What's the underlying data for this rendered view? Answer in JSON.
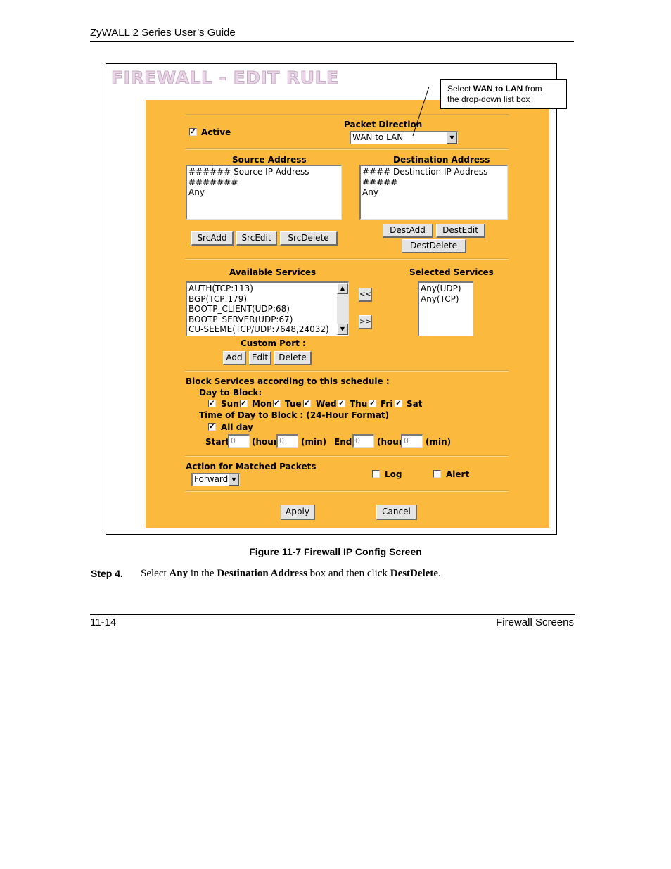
{
  "header": {
    "title": "ZyWALL 2 Series User’s Guide"
  },
  "screen": {
    "title": "FIREWALL - EDIT RULE",
    "active_label": "Active",
    "active_checked": true,
    "packet_direction_label": "Packet Direction",
    "packet_direction_value": "WAN to LAN",
    "source_address_label": "Source Address",
    "source_list": [
      "###### Source IP Address #######",
      "Any"
    ],
    "destination_address_label": "Destination Address",
    "destination_list": [
      "#### Destinction IP Address #####",
      "Any"
    ],
    "src_buttons": {
      "add": "SrcAdd",
      "edit": "SrcEdit",
      "delete": "SrcDelete"
    },
    "dest_buttons": {
      "add": "DestAdd",
      "edit": "DestEdit",
      "delete": "DestDelete"
    },
    "available_services_label": "Available Services",
    "available_services": [
      "AUTH(TCP:113)",
      "BGP(TCP:179)",
      "BOOTP_CLIENT(UDP:68)",
      "BOOTP_SERVER(UDP:67)",
      "CU-SEEME(TCP/UDP:7648,24032)"
    ],
    "selected_services_label": "Selected Services",
    "selected_services": [
      "Any(UDP)",
      "Any(TCP)"
    ],
    "move_left": "<<",
    "move_right": ">>",
    "custom_port_label": "Custom Port :",
    "custom_buttons": {
      "add": "Add",
      "edit": "Edit",
      "delete": "Delete"
    },
    "schedule_label": "Block Services according to this schedule :",
    "day_to_block_label": "Day to Block:",
    "days": [
      "Sun",
      "Mon",
      "Tue",
      "Wed",
      "Thu",
      "Fri",
      "Sat"
    ],
    "time_label": "Time of Day to Block : (24-Hour Format)",
    "all_day_label": "All day",
    "start_label": "Start:",
    "end_label": "End:",
    "hour_label": "(hour)",
    "min_label": "(min)",
    "time_values": {
      "start_hour": "0",
      "start_min": "0",
      "end_hour": "0",
      "end_min": "0"
    },
    "action_label": "Action for Matched Packets",
    "action_value": "Forward",
    "log_label": "Log",
    "alert_label": "Alert",
    "apply_label": "Apply",
    "cancel_label": "Cancel"
  },
  "callout": {
    "prefix": "Select ",
    "bold": "WAN to LAN",
    "suffix": " from",
    "line2": "the drop-down list box"
  },
  "caption": "Figure 11-7 Firewall IP Config Screen",
  "step": {
    "label": "Step 4.",
    "t1": "Select ",
    "b1": "Any",
    "t2": " in the ",
    "b2": "Destination Address",
    "t3": " box and then click ",
    "b3": "DestDelete",
    "t4": "."
  },
  "footer": {
    "left": "11-14",
    "right": "Firewall Screens"
  }
}
